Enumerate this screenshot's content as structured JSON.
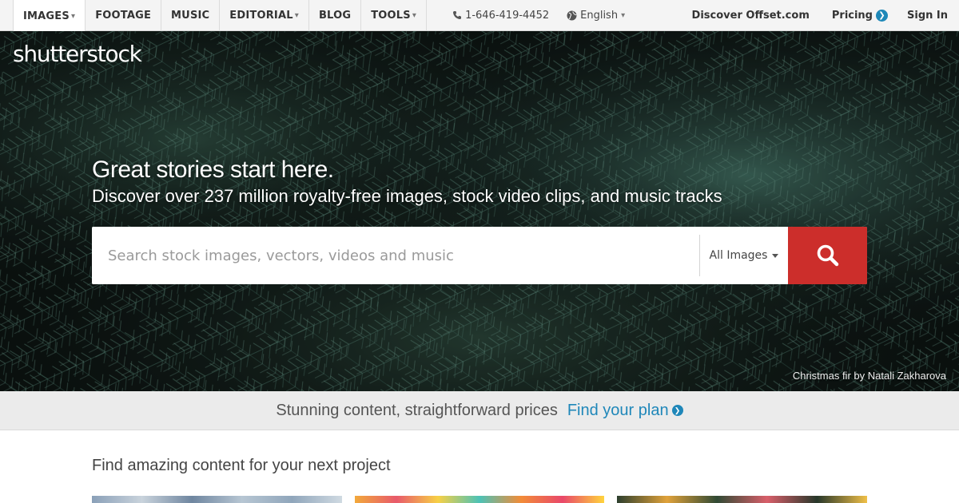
{
  "nav": {
    "items": [
      {
        "label": "IMAGES",
        "has_caret": true
      },
      {
        "label": "FOOTAGE",
        "has_caret": false
      },
      {
        "label": "MUSIC",
        "has_caret": false
      },
      {
        "label": "EDITORIAL",
        "has_caret": true
      },
      {
        "label": "BLOG",
        "has_caret": false
      },
      {
        "label": "TOOLS",
        "has_caret": true
      }
    ],
    "phone": "1-646-419-4452",
    "language": "English",
    "discover": "Discover Offset.com",
    "pricing": "Pricing",
    "signin": "Sign In",
    "caret_glyph": "▾"
  },
  "hero": {
    "logo": "shutterstock",
    "headline": "Great stories start here.",
    "subline": "Discover over 237 million royalty-free images, stock video clips, and music tracks",
    "credit": "Christmas fir by Natali Zakharova"
  },
  "search": {
    "placeholder": "Search stock images, vectors, videos and music",
    "value": "",
    "type": "All Images"
  },
  "promo": {
    "text": "Stunning content, straightforward prices",
    "link": "Find your plan"
  },
  "section": {
    "title": "Find amazing content for your next project"
  },
  "colors": {
    "accent_red": "#cc2e2b",
    "link_blue": "#1f87b9",
    "nav_bg": "#f4f4f4"
  },
  "icons": [
    "phone-icon",
    "globe-icon",
    "search-icon",
    "chevron-right-icon"
  ]
}
